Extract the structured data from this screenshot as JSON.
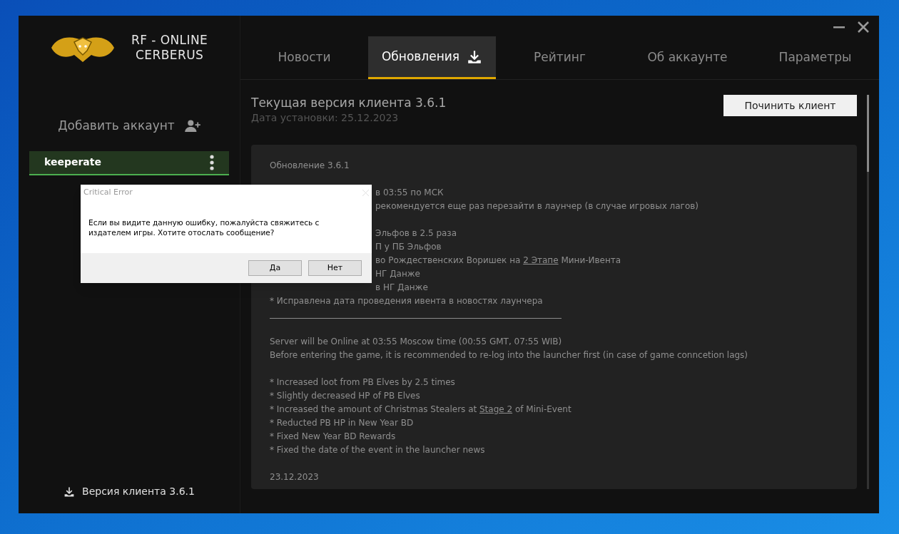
{
  "logo": {
    "line1": "RF - ONLINE",
    "line2": "CERBERUS"
  },
  "add_account": "Добавить аккаунт",
  "accounts": [
    {
      "name": "keeperate",
      "selected": true
    }
  ],
  "client_version": "Версия клиента 3.6.1",
  "tabs": [
    {
      "label": "Новости",
      "selected": false,
      "kind": "plain"
    },
    {
      "label": "Обновления",
      "selected": true,
      "kind": "download"
    },
    {
      "label": "Рейтинг",
      "selected": false,
      "kind": "plain"
    },
    {
      "label": "Об аккаунте",
      "selected": false,
      "kind": "plain"
    },
    {
      "label": "Параметры",
      "selected": false,
      "kind": "plain"
    }
  ],
  "current_version": "Текущая версия клиента 3.6.1",
  "install_date": "Дата установки: 25.12.2023",
  "repair_button": "Починить клиент",
  "update_notes": [
    {
      "kind": "text",
      "covered": false,
      "parts": [
        {
          "text": "Обновление 3.6.1",
          "link": false
        }
      ]
    },
    {
      "kind": "gap"
    },
    {
      "kind": "text",
      "covered": true,
      "parts": [
        {
          "text": "в 03:55 по МСК",
          "link": false
        }
      ]
    },
    {
      "kind": "text",
      "covered": true,
      "parts": [
        {
          "text": "рекомендуется еще раз перезайти в лаунчер (в случае игровых лагов)",
          "link": false
        }
      ]
    },
    {
      "kind": "gap"
    },
    {
      "kind": "text",
      "covered": true,
      "parts": [
        {
          "text": "Эльфов в 2.5 раза",
          "link": false
        }
      ]
    },
    {
      "kind": "text",
      "covered": true,
      "parts": [
        {
          "text": "П у ПБ Эльфов",
          "link": false
        }
      ]
    },
    {
      "kind": "text",
      "covered": true,
      "parts": [
        {
          "text": "во Рождественских Воришек на ",
          "link": false
        },
        {
          "text": "2 Этапе",
          "link": true
        },
        {
          "text": " Мини-Ивента",
          "link": false
        }
      ]
    },
    {
      "kind": "text",
      "covered": true,
      "parts": [
        {
          "text": "НГ Данже",
          "link": false
        }
      ]
    },
    {
      "kind": "text",
      "covered": true,
      "parts": [
        {
          "text": "в НГ Данже",
          "link": false
        }
      ]
    },
    {
      "kind": "text",
      "covered": false,
      "parts": [
        {
          "text": "* Исправлена дата проведения ивента в новостях лаунчера",
          "link": false
        }
      ]
    },
    {
      "kind": "rule"
    },
    {
      "kind": "gap"
    },
    {
      "kind": "text",
      "covered": false,
      "parts": [
        {
          "text": "Server will be Online at 03:55 Moscow time (00:55 GMT, 07:55 WIB)",
          "link": false
        }
      ]
    },
    {
      "kind": "text",
      "covered": false,
      "parts": [
        {
          "text": "Before entering the game, it is recommended to re-log into the launcher first (in case of game conncetion lags)",
          "link": false
        }
      ]
    },
    {
      "kind": "gap"
    },
    {
      "kind": "text",
      "covered": false,
      "parts": [
        {
          "text": "* Increased loot from PB Elves by 2.5 times",
          "link": false
        }
      ]
    },
    {
      "kind": "text",
      "covered": false,
      "parts": [
        {
          "text": "* Slightly decreased HP of PB Elves",
          "link": false
        }
      ]
    },
    {
      "kind": "text",
      "covered": false,
      "parts": [
        {
          "text": "* Increased the amount of Christmas Stealers at ",
          "link": false
        },
        {
          "text": "Stage 2",
          "link": true
        },
        {
          "text": " of Mini-Event",
          "link": false
        }
      ]
    },
    {
      "kind": "text",
      "covered": false,
      "parts": [
        {
          "text": "* Reducted PB HP in New Year BD",
          "link": false
        }
      ]
    },
    {
      "kind": "text",
      "covered": false,
      "parts": [
        {
          "text": "* Fixed New Year BD Rewards",
          "link": false
        }
      ]
    },
    {
      "kind": "text",
      "covered": false,
      "parts": [
        {
          "text": "* Fixed the date of the event in the launcher news",
          "link": false
        }
      ]
    },
    {
      "kind": "gap"
    },
    {
      "kind": "text",
      "covered": false,
      "parts": [
        {
          "text": "23.12.2023",
          "link": false
        }
      ]
    }
  ],
  "dialog": {
    "title": "Critical Error",
    "message": "Если вы видите данную ошибку, пожалуйста свяжитесь с издателем игры. Хотите отослать сообщение?",
    "buttons": [
      "Да",
      "Нет"
    ]
  }
}
